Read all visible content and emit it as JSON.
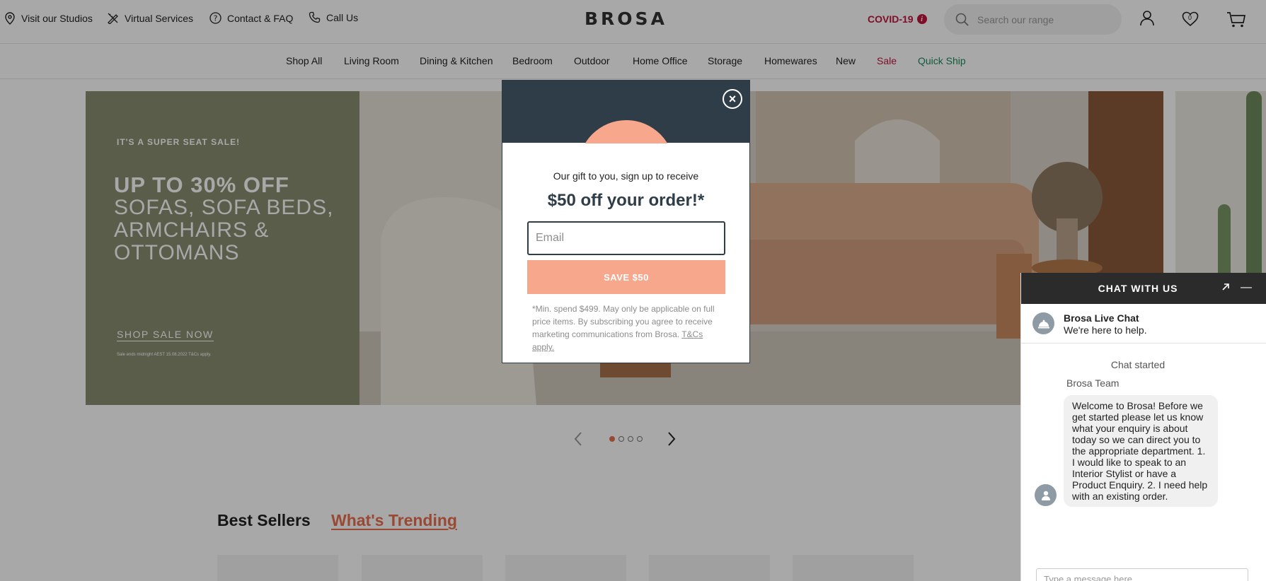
{
  "utility_links": [
    {
      "label": "Visit our Studios",
      "icon": "location-pin-icon"
    },
    {
      "label": "Virtual Services",
      "icon": "pencil-ruler-icon"
    },
    {
      "label": "Contact & FAQ",
      "icon": "question-circle-icon"
    },
    {
      "label": "Call Us",
      "icon": "phone-icon"
    }
  ],
  "brand": {
    "logo": "BROSA"
  },
  "covid": {
    "label": "COVID-19",
    "info_glyph": "i"
  },
  "search": {
    "placeholder": "Search our range"
  },
  "header_icons": {
    "account": "user-icon",
    "wishlist": "heart-icon",
    "wishlist_count": "0",
    "cart": "cart-icon"
  },
  "nav": {
    "items": [
      "Shop All",
      "Living Room",
      "Dining & Kitchen",
      "Bedroom",
      "Outdoor",
      "Home Office",
      "Storage",
      "Homewares",
      "New",
      "Sale",
      "Quick Ship"
    ]
  },
  "hero": {
    "kicker": "IT'S A SUPER SEAT SALE!",
    "headline": "UP TO 30% OFF",
    "subline": "SOFAS, SOFA BEDS, ARMCHAIRS & OTTOMANS",
    "cta": "SHOP SALE NOW",
    "fine_print": "Sale ends midnight AEST 15.08.2022 T&Cs apply."
  },
  "carousel": {
    "slide_count": 4,
    "active_index": 0
  },
  "tabs": {
    "best": "Best Sellers",
    "trending": "What's Trending"
  },
  "modal": {
    "close_glyph": "×",
    "intro": "Our gift to you, sign up to receive",
    "offer": "$50 off your order!*",
    "email_placeholder": "Email",
    "button": "SAVE $50",
    "fine_print": "*Min. spend $499. May only be applicable on full price items. By subscribing you agree to receive marketing communications from Brosa. ",
    "terms_link": "T&Cs apply."
  },
  "chat": {
    "title": "CHAT WITH US",
    "popout_icon": "external-link-icon",
    "minimize_glyph": "—",
    "agent_name": "Brosa Live Chat",
    "agent_tagline": "We're here to help.",
    "started": "Chat started",
    "sender": "Brosa Team",
    "message": "Welcome to Brosa! Before we get started please let us know what your enquiry is about today so we can direct you to the appropriate department. 1. I would like to speak to an Interior Stylist or have a Product Enquiry. 2. I need help with an existing order.",
    "input_placeholder": "Type a message here"
  },
  "colors": {
    "accent": "#e8704e",
    "sale": "#c0143c",
    "quick_ship": "#1b8a5a",
    "modal_dark": "#2f3d48",
    "peach": "#f7a78c",
    "hero_panel": "#8a8d72"
  }
}
